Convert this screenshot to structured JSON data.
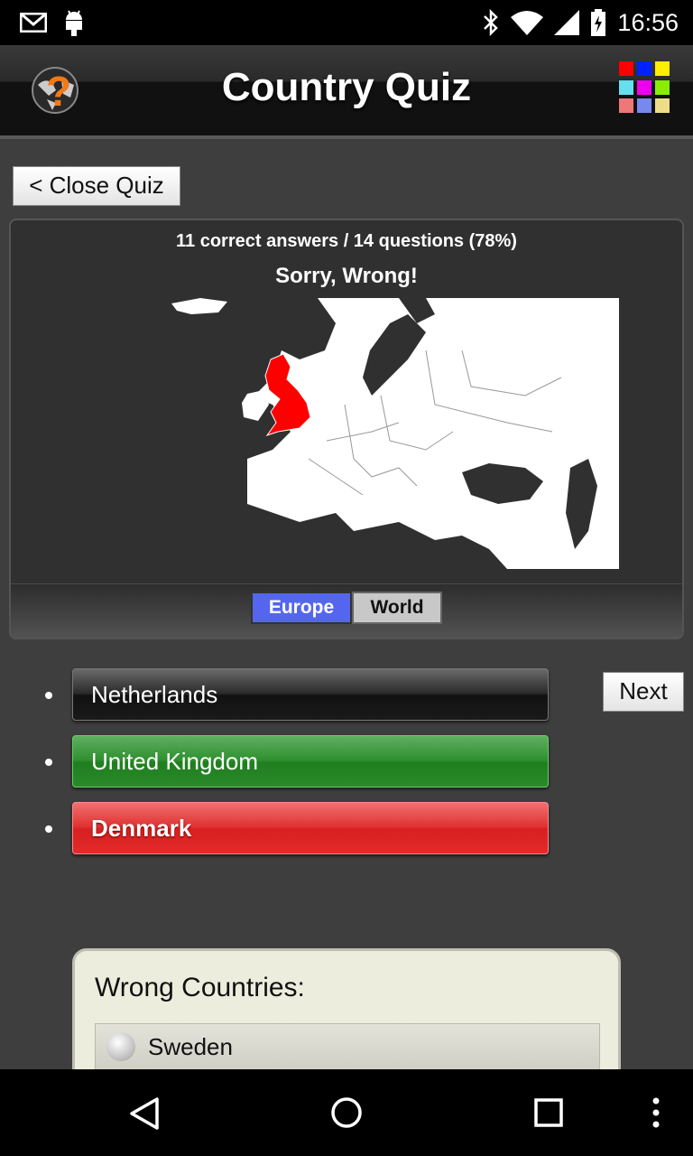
{
  "status_bar": {
    "time": "16:56",
    "left_icons": [
      "gmail-icon",
      "android-icon"
    ],
    "right_icons": [
      "bluetooth-icon",
      "wifi-icon",
      "signal-icon",
      "battery-icon"
    ]
  },
  "header": {
    "title": "Country Quiz",
    "logo_icon": "globe-question-icon",
    "menu_icon": "color-grid-icon",
    "grid_colors": [
      "#ff0000",
      "#0022ff",
      "#ffee00",
      "#66e0ee",
      "#ee00ee",
      "#88ee00",
      "#ee7777",
      "#7788ee",
      "#eedd88"
    ]
  },
  "close_quiz": {
    "label": "< Close Quiz"
  },
  "quiz": {
    "score_text": "11 correct answers / 14 questions (78%)",
    "result_text": "Sorry, Wrong!",
    "highlighted_country": "United Kingdom",
    "highlight_color": "#ff0000",
    "tabs": [
      {
        "label": "Europe",
        "active": true
      },
      {
        "label": "World",
        "active": false
      }
    ]
  },
  "answers": [
    {
      "label": "Netherlands",
      "state": "neutral"
    },
    {
      "label": "United Kingdom",
      "state": "correct"
    },
    {
      "label": "Denmark",
      "state": "wrong"
    }
  ],
  "next_button": {
    "label": "Next"
  },
  "wrong_countries": {
    "title": "Wrong Countries:",
    "items": [
      {
        "label": "Sweden",
        "icon": "wikipedia-icon"
      }
    ]
  },
  "nav_bar": {
    "icons": [
      "back-icon",
      "home-icon",
      "recents-icon",
      "overflow-menu-icon"
    ]
  }
}
